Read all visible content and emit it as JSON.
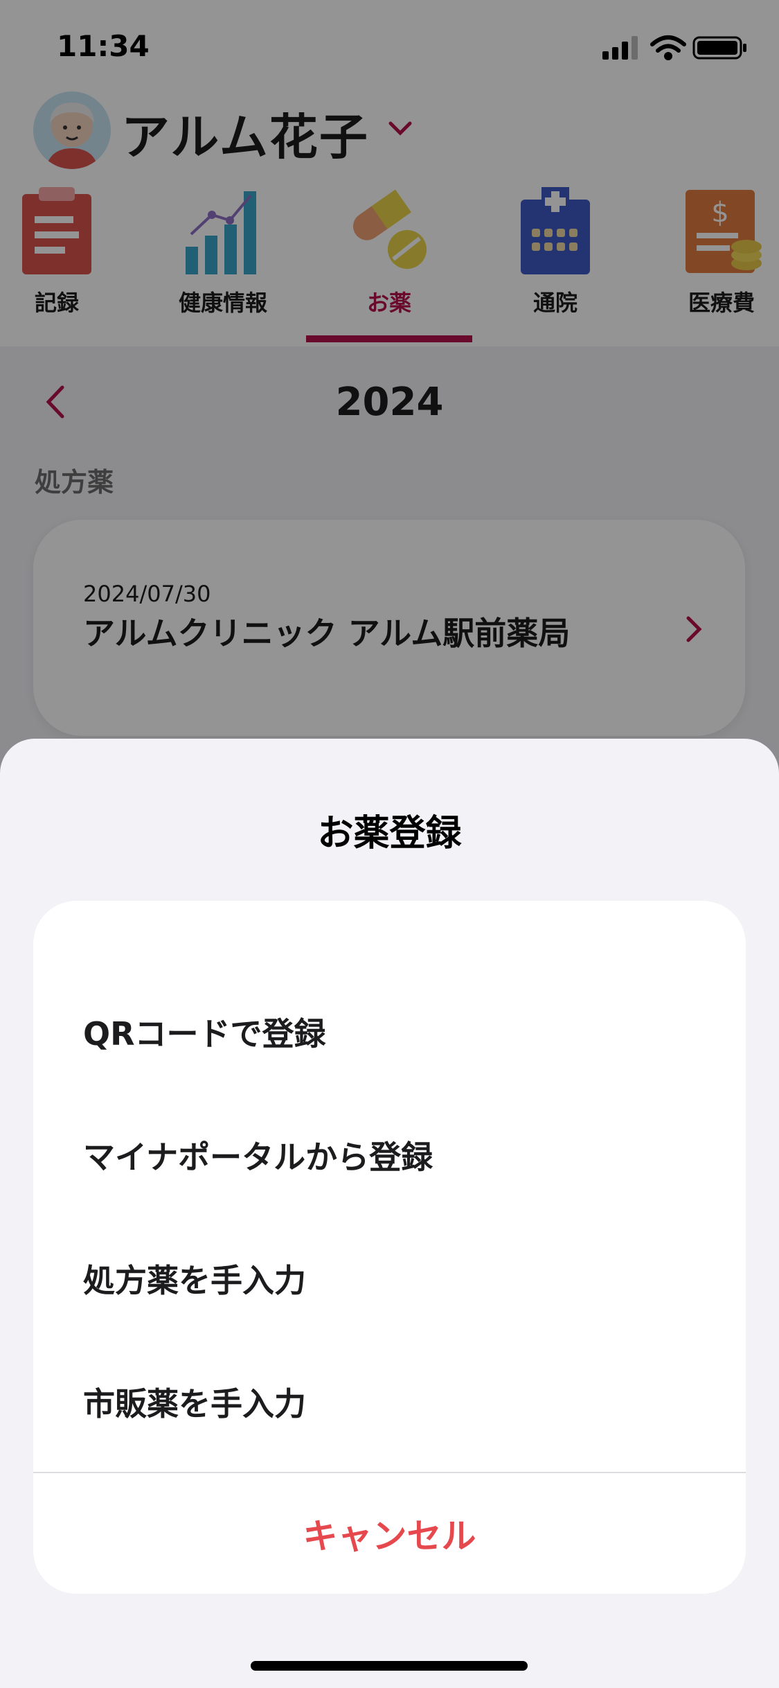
{
  "status_bar": {
    "time": "11:34"
  },
  "header": {
    "user_name": "アルム花子"
  },
  "tabs": [
    {
      "label": "記録",
      "icon": "clipboard-icon"
    },
    {
      "label": "健康情報",
      "icon": "bar-chart-icon"
    },
    {
      "label": "お薬",
      "icon": "pill-icon",
      "active": true
    },
    {
      "label": "通院",
      "icon": "hospital-icon"
    },
    {
      "label": "医療費",
      "icon": "invoice-icon"
    }
  ],
  "year_nav": {
    "year": "2024"
  },
  "section_label": "処方薬",
  "prescription": {
    "date": "2024/07/30",
    "name": "アルムクリニック アルム駅前薬局"
  },
  "sheet": {
    "title": "お薬登録",
    "options": [
      {
        "label": "QRコードで登録"
      },
      {
        "label": "マイナポータルから登録"
      },
      {
        "label": "処方薬を手入力"
      },
      {
        "label": "市販薬を手入力"
      }
    ],
    "cancel_label": "キャンセル"
  },
  "colors": {
    "accent": "#b5104a",
    "cancel": "#e5484d",
    "sheet_bg": "#f2f2f7"
  }
}
